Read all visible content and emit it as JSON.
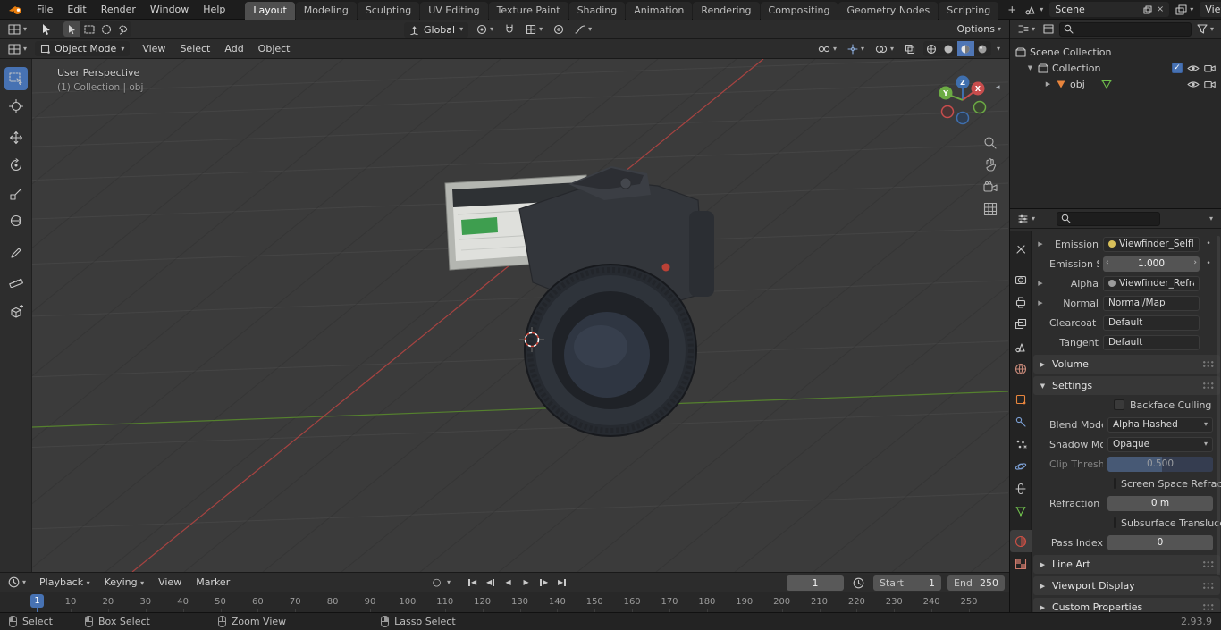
{
  "icons": {
    "chevron_down": "▾",
    "disclosure_open": "▼",
    "disclosure_closed": "▶",
    "check": "✓",
    "close": "×",
    "dot": "•",
    "panel_toggle_left": "◂",
    "spin_left": "‹",
    "spin_right": "›",
    "play_left": "◀",
    "play_right": "▶",
    "record_circle": "○"
  },
  "topbar": {
    "menus": [
      "File",
      "Edit",
      "Render",
      "Window",
      "Help"
    ],
    "workspaces": [
      {
        "label": "Layout",
        "active": true
      },
      {
        "label": "Modeling"
      },
      {
        "label": "Sculpting"
      },
      {
        "label": "UV Editing"
      },
      {
        "label": "Texture Paint"
      },
      {
        "label": "Shading"
      },
      {
        "label": "Animation"
      },
      {
        "label": "Rendering"
      },
      {
        "label": "Compositing"
      },
      {
        "label": "Geometry Nodes"
      },
      {
        "label": "Scripting"
      }
    ],
    "add_workspace_label": "+",
    "scene_field": {
      "value": "Scene"
    },
    "view_layer_field": {
      "value": "View Layer"
    }
  },
  "tool_settings": {
    "orientation_value": "Global",
    "options_label": "Options"
  },
  "viewport_header": {
    "mode_value": "Object Mode",
    "menus": [
      "View",
      "Select",
      "Add",
      "Object"
    ]
  },
  "viewport": {
    "view_label": "User Perspective",
    "context_label": "(1) Collection | obj",
    "gizmo_axes": {
      "x": "X",
      "y": "Y",
      "z": "Z"
    }
  },
  "outliner": {
    "scene_collection_label": "Scene Collection",
    "collection_label": "Collection",
    "object_label": "obj"
  },
  "properties": {
    "surface": {
      "emission_label": "Emission",
      "emission_value": "Viewfinder_SelfIllum...",
      "emission_strength_label": "Emission Strengt",
      "emission_strength_value": "1.000",
      "alpha_label": "Alpha",
      "alpha_value": "Viewfinder_Refracti...",
      "normal_label": "Normal",
      "normal_value": "Normal/Map",
      "clearcoat_normal_label": "Clearcoat Normal",
      "clearcoat_normal_value": "Default",
      "tangent_label": "Tangent",
      "tangent_value": "Default"
    },
    "panels": {
      "volume": "Volume",
      "settings": "Settings",
      "line_art": "Line Art",
      "viewport_display": "Viewport Display",
      "custom_properties": "Custom Properties"
    },
    "settings": {
      "backface_culling_label": "Backface Culling",
      "blend_mode_label": "Blend Mode",
      "blend_mode_value": "Alpha Hashed",
      "shadow_mode_label": "Shadow Mode",
      "shadow_mode_value": "Opaque",
      "clip_threshold_label": "Clip Threshold",
      "clip_threshold_value": "0.500",
      "screen_space_refraction_label": "Screen Space Refraction",
      "refraction_depth_label": "Refraction Depth",
      "refraction_depth_value": "0 m",
      "subsurface_translucency_label": "Subsurface Translucency",
      "pass_index_label": "Pass Index",
      "pass_index_value": "0"
    }
  },
  "timeline": {
    "menu_playback": "Playback",
    "menu_keying": "Keying",
    "menu_view": "View",
    "menu_marker": "Marker",
    "current_frame": "1",
    "start_label": "Start",
    "start_value": "1",
    "end_label": "End",
    "end_value": "250",
    "playhead_label": "1",
    "ruler": [
      10,
      20,
      30,
      40,
      50,
      60,
      70,
      80,
      90,
      100,
      110,
      120,
      130,
      140,
      150,
      160,
      170,
      180,
      190,
      200,
      210,
      220,
      230,
      240,
      250
    ]
  },
  "statusbar": {
    "hints": [
      "Select",
      "Box Select",
      "Zoom View",
      "Lasso Select"
    ],
    "version": "2.93.9"
  },
  "colors": {
    "accent_blue": "#4772b3",
    "object_orange": "#e8853d",
    "axis_x_red": "#c84d4d",
    "axis_y_green": "#6cab44",
    "axis_z_blue": "#3f6fae"
  }
}
